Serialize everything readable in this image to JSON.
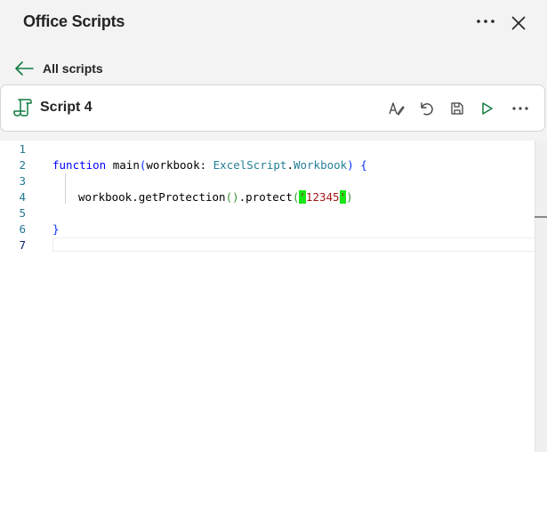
{
  "header": {
    "title": "Office Scripts",
    "more_icon": "more-horizontal-icon",
    "close_icon": "close-icon"
  },
  "nav": {
    "back_label": "All scripts",
    "back_icon": "arrow-left-icon"
  },
  "script_card": {
    "title": "Script 4",
    "icon": "script-scroll-icon",
    "tools": [
      {
        "name": "rename-icon"
      },
      {
        "name": "undo-icon"
      },
      {
        "name": "save-icon"
      },
      {
        "name": "run-icon"
      },
      {
        "name": "more-horizontal-icon"
      }
    ]
  },
  "editor": {
    "line_numbers": [
      "1",
      "2",
      "3",
      "4",
      "5",
      "6",
      "7"
    ],
    "active_line": "7",
    "code": {
      "l2_kw": "function",
      "l2_fn": " main",
      "l2_open": "(",
      "l2_param": "workbook: ",
      "l2_type1": "ExcelScript",
      "l2_dot": ".",
      "l2_type2": "Workbook",
      "l2_close": ")",
      "l2_space": " ",
      "l2_brace": "{",
      "l4_text": "workbook.getProtection",
      "l4_paren_open": "(",
      "l4_paren_close": ")",
      "l4_method": ".protect",
      "l4_call_open": "(",
      "l4_q1": "'",
      "l4_str": "12345",
      "l4_q2": "'",
      "l4_call_close": ")",
      "l6_brace": "}"
    },
    "colors": {
      "keyword": "#0000ff",
      "type": "#267f99",
      "string": "#a31515",
      "bracket_match_bg": "#16e616",
      "line_number": "#237893"
    }
  }
}
